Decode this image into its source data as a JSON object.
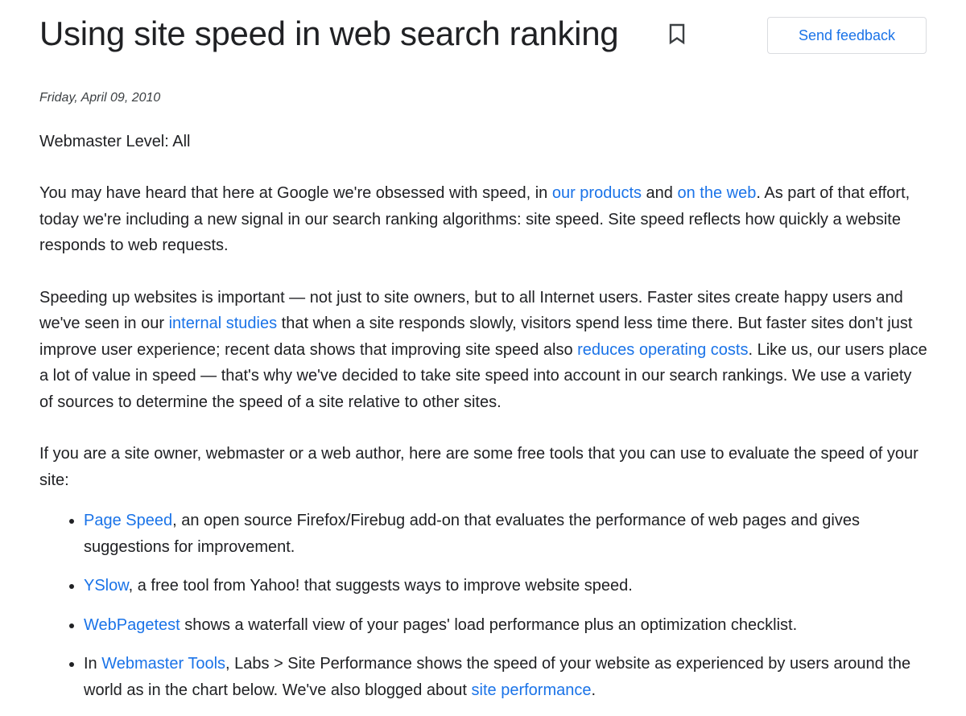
{
  "header": {
    "title": "Using site speed in web search ranking",
    "bookmark_icon": "bookmark-icon",
    "feedback_label": "Send feedback"
  },
  "article": {
    "date": "Friday, April 09, 2010",
    "level": "Webmaster Level: All",
    "p1": {
      "t1": "You may have heard that here at Google we're obsessed with speed, in ",
      "l1": "our products",
      "t2": " and ",
      "l2": "on the web",
      "t3": ". As part of that effort, today we're including a new signal in our search ranking algorithms: site speed. Site speed reflects how quickly a website responds to web requests."
    },
    "p2": {
      "t1": "Speeding up websites is important — not just to site owners, but to all Internet users. Faster sites create happy users and we've seen in our ",
      "l1": "internal studies",
      "t2": " that when a site responds slowly, visitors spend less time there. But faster sites don't just improve user experience; recent data shows that improving site speed also ",
      "l2": "reduces operating costs",
      "t3": ". Like us, our users place a lot of value in speed — that's why we've decided to take site speed into account in our search rankings. We use a variety of sources to determine the speed of a site relative to other sites."
    },
    "p3": "If you are a site owner, webmaster or a web author, here are some free tools that you can use to evaluate the speed of your site:",
    "tools": [
      {
        "prefix": "",
        "link": "Page Speed",
        "text": ", an open source Firefox/Firebug add-on that evaluates the performance of web pages and gives suggestions for improvement."
      },
      {
        "prefix": "",
        "link": "YSlow",
        "text": ", a free tool from Yahoo! that suggests ways to improve website speed."
      },
      {
        "prefix": "",
        "link": "WebPagetest",
        "text": " shows a waterfall view of your pages' load performance plus an optimization checklist."
      },
      {
        "prefix": "In ",
        "link": "Webmaster Tools",
        "text": ", Labs > Site Performance shows the speed of your website as experienced by users around the world as in the chart below. We've also blogged about ",
        "link2": "site performance",
        "suffix": "."
      }
    ]
  },
  "colors": {
    "link": "#1a73e8",
    "text": "#202124",
    "border": "#dadce0"
  }
}
